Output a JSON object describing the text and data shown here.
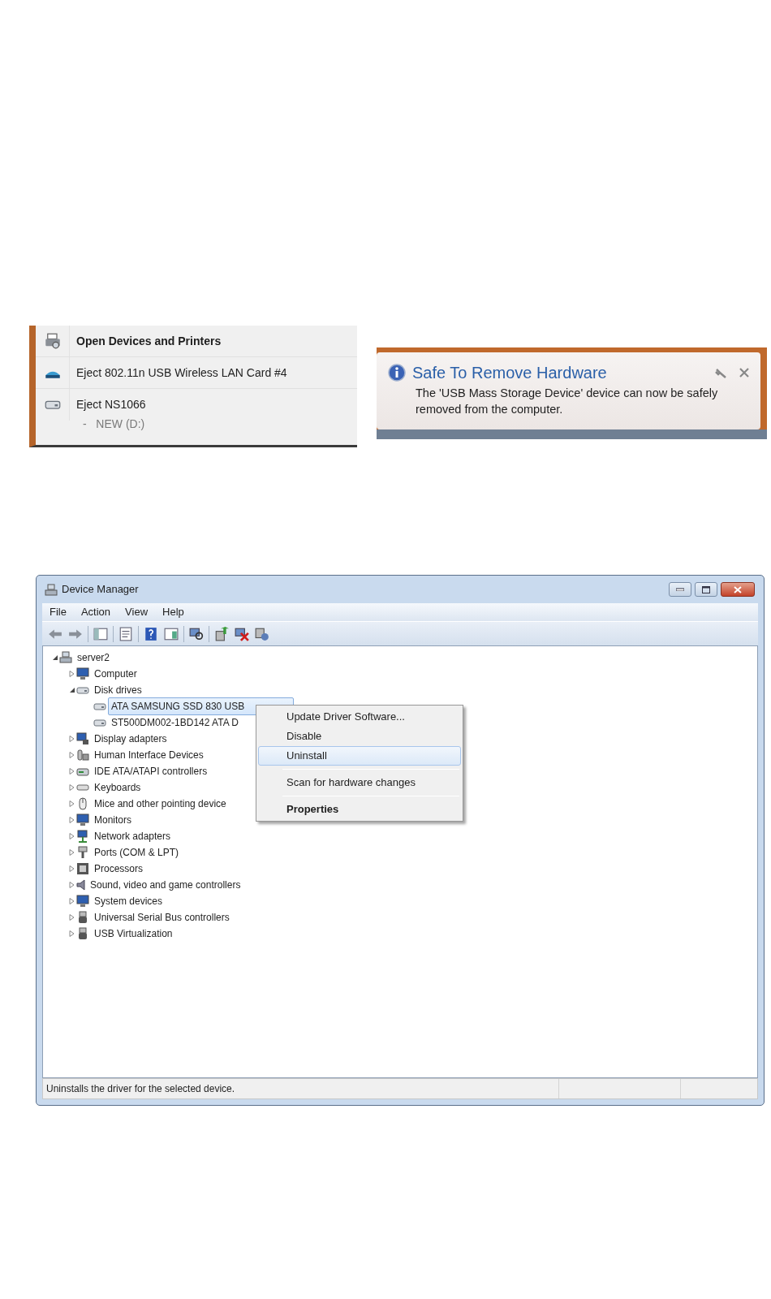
{
  "tray_menu": {
    "items": [
      {
        "label": "Open Devices and Printers",
        "bold": true
      },
      {
        "label": "Eject 802.11n USB Wireless LAN Card #4",
        "bold": false
      },
      {
        "label": "Eject NS1066",
        "bold": false,
        "sub_label": "-   NEW (D:)"
      }
    ]
  },
  "notification": {
    "title": "Safe To Remove Hardware",
    "message": "The 'USB Mass Storage Device' device can now be safely removed from the computer."
  },
  "window": {
    "title": "Device Manager"
  },
  "menu_bar": [
    "File",
    "Action",
    "View",
    "Help"
  ],
  "tree": [
    {
      "label": "server2",
      "expanded": true,
      "selected": false,
      "children": [
        {
          "label": "Computer",
          "expanded": false,
          "selected": false
        },
        {
          "label": "Disk drives",
          "expanded": true,
          "selected": false,
          "children": [
            {
              "label": "ATA SAMSUNG SSD 830 USB",
              "selected": true
            },
            {
              "label": "ST500DM002-1BD142 ATA D",
              "selected": false
            }
          ]
        },
        {
          "label": "Display adapters",
          "expanded": false,
          "selected": false
        },
        {
          "label": "Human Interface Devices",
          "expanded": false,
          "selected": false
        },
        {
          "label": "IDE ATA/ATAPI controllers",
          "expanded": false,
          "selected": false
        },
        {
          "label": "Keyboards",
          "expanded": false,
          "selected": false
        },
        {
          "label": "Mice and other pointing device",
          "expanded": false,
          "selected": false
        },
        {
          "label": "Monitors",
          "expanded": false,
          "selected": false
        },
        {
          "label": "Network adapters",
          "expanded": false,
          "selected": false
        },
        {
          "label": "Ports (COM & LPT)",
          "expanded": false,
          "selected": false
        },
        {
          "label": "Processors",
          "expanded": false,
          "selected": false
        },
        {
          "label": "Sound, video and game controllers",
          "expanded": false,
          "selected": false
        },
        {
          "label": "System devices",
          "expanded": false,
          "selected": false
        },
        {
          "label": "Universal Serial Bus controllers",
          "expanded": false,
          "selected": false
        },
        {
          "label": "USB Virtualization",
          "expanded": false,
          "selected": false
        }
      ]
    }
  ],
  "context_menu": {
    "groups": [
      [
        {
          "label": "Update Driver Software...",
          "selected": false,
          "default": false
        },
        {
          "label": "Disable",
          "selected": false,
          "default": false
        },
        {
          "label": "Uninstall",
          "selected": true,
          "default": false
        }
      ],
      [
        {
          "label": "Scan for hardware changes",
          "selected": false,
          "default": false
        }
      ],
      [
        {
          "label": "Properties",
          "selected": false,
          "default": true
        }
      ]
    ]
  },
  "status_bar": {
    "text": "Uninstalls the driver for the selected device."
  }
}
